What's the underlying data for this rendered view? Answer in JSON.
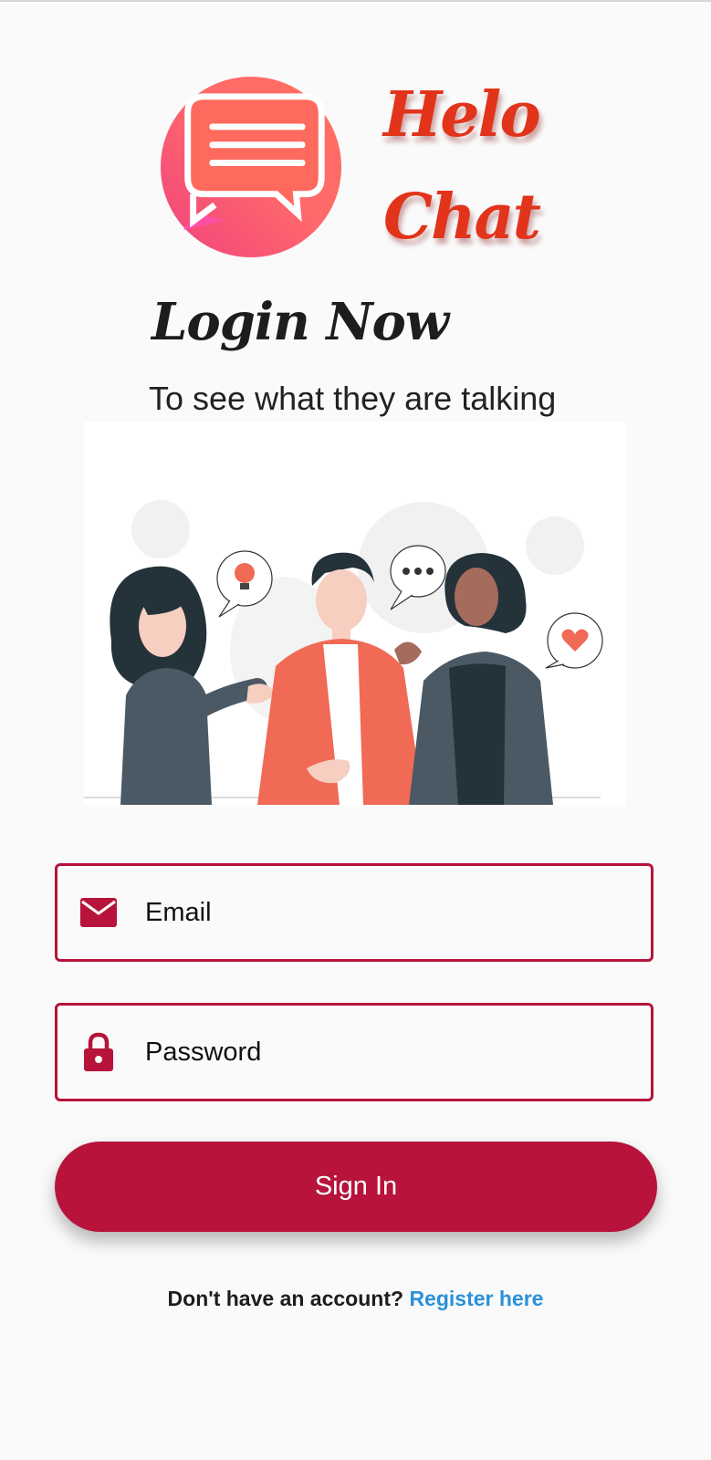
{
  "brand": {
    "line1": "Helo",
    "line2": "Chat",
    "logo_icon": "chat-bubble-icon",
    "colors": {
      "brand_red": "#e2331b",
      "logo_gradient_start": "#f0427f",
      "logo_gradient_end": "#ff6f5f"
    }
  },
  "login": {
    "title": "Login Now",
    "subtitle": "To see what they are talking"
  },
  "illustration": {
    "name": "people-talking-illustration"
  },
  "form": {
    "email_placeholder": "Email",
    "password_placeholder": "Password",
    "email_icon": "mail-icon",
    "password_icon": "lock-icon"
  },
  "actions": {
    "signin_label": "Sign In"
  },
  "footer": {
    "prompt": "Don't have an account? ",
    "link": "Register here"
  },
  "colors": {
    "accent": "#b7133b",
    "link": "#2a91d9",
    "background": "#fafafa"
  }
}
